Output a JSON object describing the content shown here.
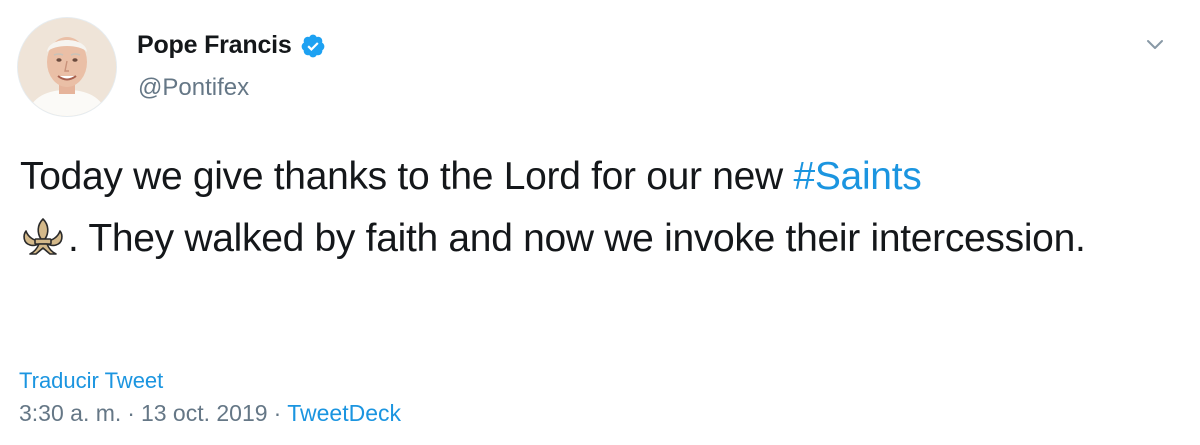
{
  "author": {
    "display_name": "Pope Francis",
    "handle": "@Pontifex",
    "verified": true,
    "avatar_icon": "avatar-photo"
  },
  "tweet": {
    "text_part1": "Today we give thanks to the Lord for our new ",
    "hashtag": "#Saints",
    "emoji": "fleur-de-lis",
    "text_part2": ". They walked by faith and now we invoke their intercession."
  },
  "translate_label": "Traducir Tweet",
  "meta": {
    "time": "3:30 a. m.",
    "separator": "·",
    "date": "13 oct. 2019",
    "source": "TweetDeck"
  },
  "icons": {
    "verified": "verified-badge-icon",
    "menu": "chevron-down-icon"
  },
  "colors": {
    "link": "#1b95e0",
    "secondary_text": "#657786",
    "primary_text": "#14171a",
    "verified_badge": "#1da1f2"
  }
}
